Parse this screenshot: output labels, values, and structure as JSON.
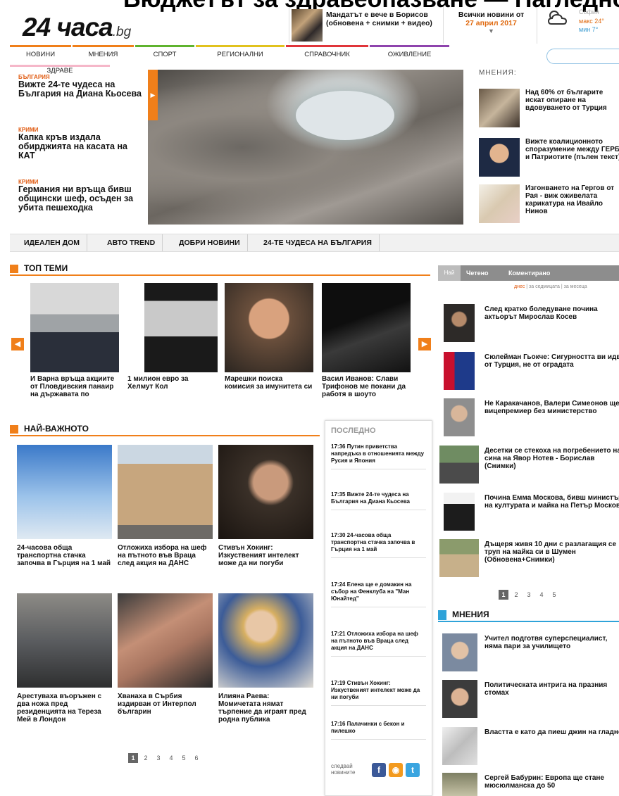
{
  "top_crop_text": "Бюджетът за здравеопазване — Нагледно",
  "header": {
    "logo_main": "24 часа",
    "logo_suffix": ".bg",
    "news_teaser": "Мандатът е вече в Борисов (обновена + снимки + видео)",
    "date_label": "Всички новини от",
    "date_value": "27 април 2017",
    "date_arrow": "▼"
  },
  "weather": {
    "city": "София",
    "max": "макс 24°",
    "min": "мин 7°"
  },
  "nav": {
    "items": [
      {
        "label": "НОВИНИ",
        "color": "#f07f1a"
      },
      {
        "label": "МНЕНИЯ",
        "color": "#f07f1a"
      },
      {
        "label": "СПОРТ",
        "color": "#5fb32e"
      },
      {
        "label": "РЕГИОНАЛНИ",
        "color": "#e1c21d"
      },
      {
        "label": "СПРАВОЧНИК",
        "color": "#e0353a"
      },
      {
        "label": "ОЖИВЛЕНИЕ",
        "color": "#8e44ad"
      }
    ],
    "sub_item": "ЗДРАВЕ"
  },
  "left_featured": [
    {
      "category": "България",
      "title": "Вижте 24-те чудеса на България на Диана Кьосева"
    },
    {
      "category": "Крими",
      "title": "Капка кръв издала обирджията на касата на КАТ"
    },
    {
      "category": "Крими",
      "title": "Германия ни връща бивш общински шеф, осъден за убита пешеходка"
    }
  ],
  "opinions_top": {
    "heading": "МНЕНИЯ:",
    "items": [
      "Над 60% от българите искат опиране на вдовуването от Турция",
      "Вижте коалиционното споразумение между ГЕРБ и Патриотите (пълен текст)",
      "Изгонването на Гергов от Рая - виж оживелата карикатура на Ивайло Нинов"
    ]
  },
  "section_bar": [
    "ИДЕАЛЕН ДОМ",
    "АВТО TREND",
    "ДОБРИ НОВИНИ",
    "24-ТЕ ЧУДЕСА НА БЪЛГАРИЯ"
  ],
  "top_themes": {
    "title": "ТОП ТЕМИ",
    "items": [
      "И Варна връща акциите от Пловдивския панаир на държавата по",
      "1 милион евро за Хелмут Кол",
      "Марешки поиска комисия за имунитета си",
      "Васил Иванов: Слави Трифонов ме покани да работя в шоуто"
    ]
  },
  "most_important": {
    "title": "НАЙ-ВАЖНОТО",
    "items": [
      "24-часова обща транспортна стачка започва в Гърция на 1 май",
      "Отложиха избора на шеф на пътното във Враца след акция на ДАНС",
      "Стивън Хокинг: Изкуственият интелект може да ни погуби",
      "Арестуваха въоръжен с два ножа пред резиденцията на Тереза Мей в Лондон",
      "Хванаха в Сърбия издирван от Интерпол българин",
      "Илияна Раева: Момичетата нямат търпение да играят пред родна публика"
    ],
    "pages": [
      "1",
      "2",
      "3",
      "4",
      "5",
      "6"
    ]
  },
  "latest": {
    "title": "ПОСЛЕДНО",
    "items": [
      "17:36 Путин приветства напредъка в отношенията между Русия и Япония",
      "17:35 Вижте 24-те чудеса на България на Диана Кьосева",
      "17:30 24-часова обща транспортна стачка започва в Гърция на 1 май",
      "17:24 Елена ще е домакин на събор на Фенклуба на \"Ман Юнайтед\"",
      "17:21 Отложиха избора на шеф на пътното във Враца след акция на ДАНС",
      "17:19 Стивън Хокинг: Изкуственият интелект може да ни погуби",
      "17:16 Палачинки с бекон и пилешко"
    ],
    "follow": "следвай новините"
  },
  "right_tabs": {
    "tab0": "Най",
    "tab1": "Четено",
    "tab2": "Коментирано",
    "sub_active": "днес",
    "sub_rest": " | за седмицата | за месеца"
  },
  "right_news": [
    "След кратко боледуване почина актьорът Мирослав Косев",
    "Сюлейман Гьокче: Сигурността ви идва от Турция, не от оградата",
    "Не Каракачанов, Валери Симеонов ще е вицепремиер без министерство",
    "Десетки се стекоха на погребението на сина на Явор Нотев - Борислав (Снимки)",
    "Почина Емма Москова, бивш министър на културата и майка на Петър Москов",
    "Дъщеря живя 10 дни с разлагащия се труп на майка си в Шумен (Обновена+Снимки)"
  ],
  "right_pages": [
    "1",
    "2",
    "3",
    "4",
    "5"
  ],
  "mneniya": {
    "title": "МНЕНИЯ",
    "items": [
      "Учител подготвя суперспециалист, няма пари за училището",
      "Политическата интрига на празния стомах",
      "Властта е като да пиеш джин на гладно",
      "Сергей Бабурин: Европа ще стане мюсюлманска до 50"
    ]
  }
}
